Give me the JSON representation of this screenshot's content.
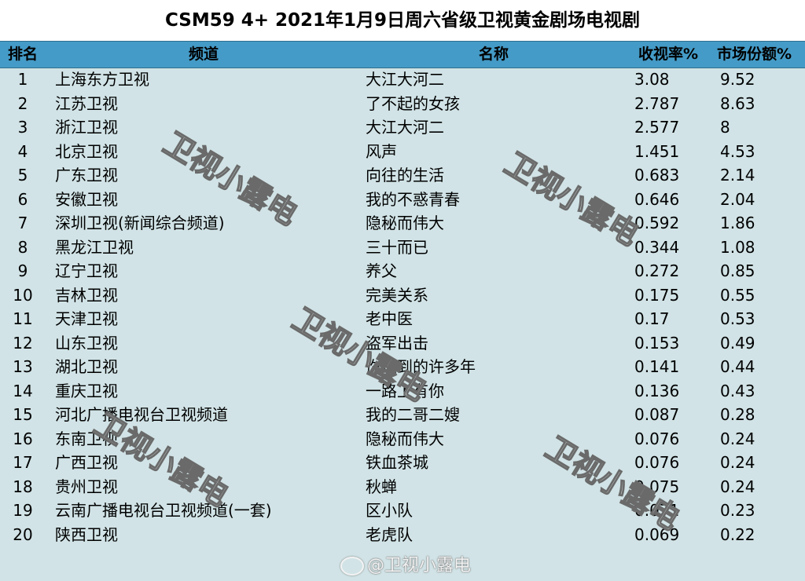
{
  "title": "CSM59 4+ 2021年1月9日周六省级卫视黄金剧场电视剧",
  "headers": {
    "rank": "排名",
    "channel": "频道",
    "show": "名称",
    "rating": "收视率%",
    "share": "市场份额%"
  },
  "rows": [
    {
      "rank": "1",
      "channel": "上海东方卫视",
      "show": "大江大河二",
      "rating": "3.08",
      "share": "9.52"
    },
    {
      "rank": "2",
      "channel": "江苏卫视",
      "show": "了不起的女孩",
      "rating": "2.787",
      "share": "8.63"
    },
    {
      "rank": "3",
      "channel": "浙江卫视",
      "show": "大江大河二",
      "rating": "2.577",
      "share": "8"
    },
    {
      "rank": "4",
      "channel": "北京卫视",
      "show": "风声",
      "rating": "1.451",
      "share": "4.53"
    },
    {
      "rank": "5",
      "channel": "广东卫视",
      "show": "向往的生活",
      "rating": "0.683",
      "share": "2.14"
    },
    {
      "rank": "6",
      "channel": "安徽卫视",
      "show": "我的不惑青春",
      "rating": "0.646",
      "share": "2.04"
    },
    {
      "rank": "7",
      "channel": "深圳卫视(新闻综合频道)",
      "show": "隐秘而伟大",
      "rating": "0.592",
      "share": "1.86"
    },
    {
      "rank": "8",
      "channel": "黑龙江卫视",
      "show": "三十而已",
      "rating": "0.344",
      "share": "1.08"
    },
    {
      "rank": "9",
      "channel": "辽宁卫视",
      "show": "养父",
      "rating": "0.272",
      "share": "0.85"
    },
    {
      "rank": "10",
      "channel": "吉林卫视",
      "show": "完美关系",
      "rating": "0.175",
      "share": "0.55"
    },
    {
      "rank": "11",
      "channel": "天津卫视",
      "show": "老中医",
      "rating": "0.17",
      "share": "0.53"
    },
    {
      "rank": "12",
      "channel": "山东卫视",
      "show": "盗军出击",
      "rating": "0.153",
      "share": "0.49"
    },
    {
      "rank": "13",
      "channel": "湖北卫视",
      "show": "你迟到的许多年",
      "rating": "0.141",
      "share": "0.44"
    },
    {
      "rank": "14",
      "channel": "重庆卫视",
      "show": "一路上有你",
      "rating": "0.136",
      "share": "0.43"
    },
    {
      "rank": "15",
      "channel": "河北广播电视台卫视频道",
      "show": "我的二哥二嫂",
      "rating": "0.087",
      "share": "0.28"
    },
    {
      "rank": "16",
      "channel": "东南卫视",
      "show": "隐秘而伟大",
      "rating": "0.076",
      "share": "0.24"
    },
    {
      "rank": "17",
      "channel": "广西卫视",
      "show": "铁血茶城",
      "rating": "0.076",
      "share": "0.24"
    },
    {
      "rank": "18",
      "channel": "贵州卫视",
      "show": "秋蝉",
      "rating": "0.075",
      "share": "0.24"
    },
    {
      "rank": "19",
      "channel": "云南广播电视台卫视频道(一套)",
      "show": "区小队",
      "rating": "0.071",
      "share": "0.23"
    },
    {
      "rank": "20",
      "channel": "陕西卫视",
      "show": "老虎队",
      "rating": "0.069",
      "share": "0.22"
    }
  ],
  "watermark": "卫视小露电",
  "weibo": "@卫视小露电",
  "colors": {
    "header_bg": "#449bc7",
    "table_bg": "#d1e3e6"
  }
}
